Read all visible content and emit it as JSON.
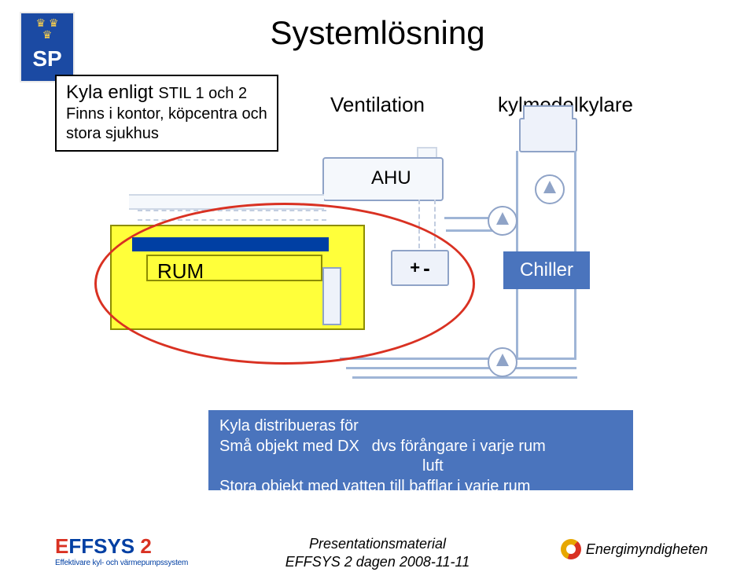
{
  "title": "Systemlösning",
  "note_box": {
    "line1_prefix": "Kyla enligt ",
    "line1_suffix": "STIL 1 och 2",
    "line2": "Finns i kontor, köpcentra och",
    "line3": "stora sjukhus"
  },
  "labels": {
    "ventilation": "Ventilation",
    "kylmedelkylare": "kylmedelkylare",
    "ahu": "AHU",
    "rum": "RUM",
    "chiller": "Chiller",
    "plus": "+",
    "minus": "-"
  },
  "conclusion": {
    "line1": "Kyla distribueras för",
    "line2_left": "Små objekt med  DX",
    "line2_right": "dvs förångare i varje rum",
    "line2b": "luft",
    "line3": "Stora objekt med vatten till bafflar i varje rum"
  },
  "footer": {
    "line1": "Presentationsmaterial",
    "line2": "EFFSYS 2 dagen 2008-11-11"
  },
  "logos": {
    "sp": "SP",
    "effsys_word": "EFFSYS",
    "effsys_num": "2",
    "effsys_tag": "Effektivare kyl- och värmepumpssystem",
    "energimyndigheten": "Energimyndigheten"
  }
}
